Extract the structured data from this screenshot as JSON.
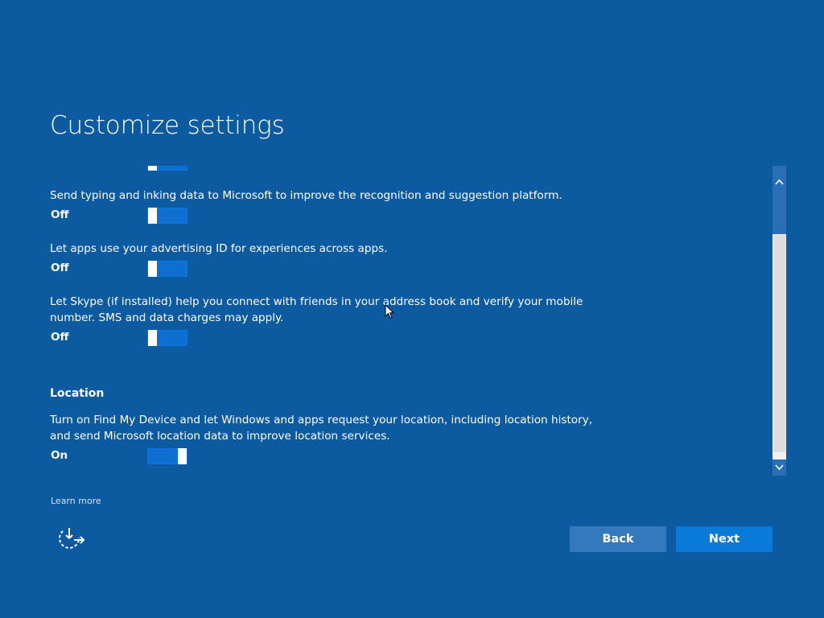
{
  "header": {
    "title": "Customize settings"
  },
  "settings": [
    {
      "description": "",
      "state": "Off",
      "partial": true
    },
    {
      "description": "Send typing and inking data to Microsoft to improve the recognition and suggestion platform.",
      "state": "Off"
    },
    {
      "description": "Let apps use your advertising ID for experiences across apps.",
      "state": "Off"
    },
    {
      "description": "Let Skype (if installed) help you connect with friends in your address book and verify your mobile number. SMS and data charges may apply.",
      "state": "Off"
    }
  ],
  "location": {
    "heading": "Location",
    "description": "Turn on Find My Device and let Windows and apps request your location, including location history, and send Microsoft location data to improve location services.",
    "state": "On"
  },
  "footer": {
    "learn_more": "Learn more",
    "back_label": "Back",
    "next_label": "Next"
  },
  "icons": {
    "accessibility": "ease-of-access-icon",
    "scroll_up": "chevron-up-icon",
    "scroll_down": "chevron-down-icon"
  },
  "colors": {
    "background": "#0c5aa0",
    "toggle_fill": "#0e6fd0",
    "next_button": "#0a7ad9",
    "back_button": "#3478bd"
  }
}
